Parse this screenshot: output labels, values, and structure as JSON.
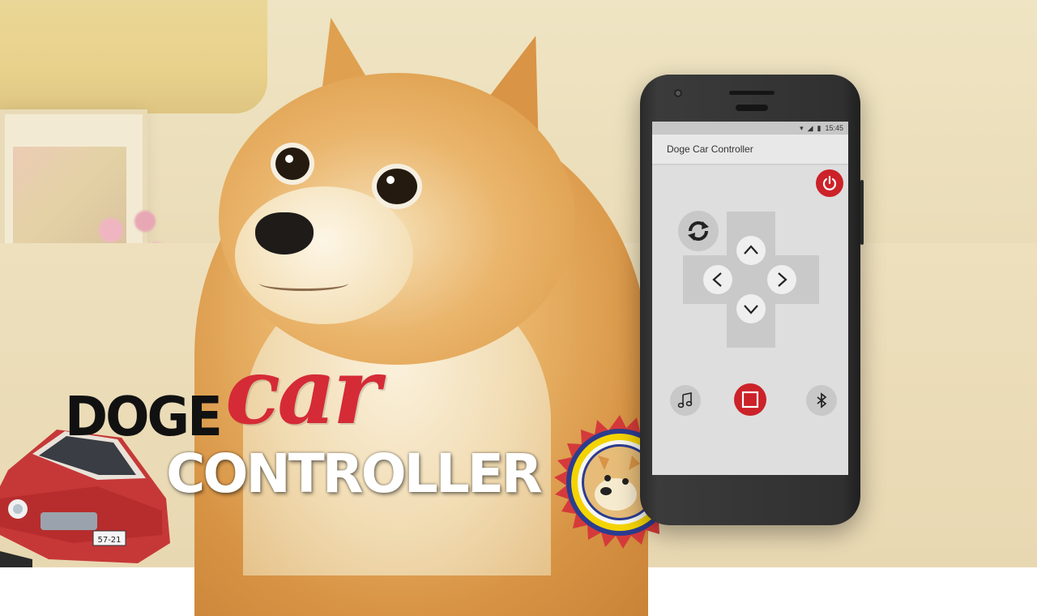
{
  "title": {
    "word1": "DOGE",
    "word2": "car",
    "word3": "CONTROLLER"
  },
  "toy_car": {
    "plate": "57-21"
  },
  "phone": {
    "status_time": "15:45",
    "app_title": "Doge Car Controller",
    "controls": {
      "power": "power-icon",
      "rotate": "rotate-icon",
      "up": "chevron-up-icon",
      "down": "chevron-down-icon",
      "left": "chevron-left-icon",
      "right": "chevron-right-icon",
      "music": "music-note-icon",
      "stop": "stop-icon",
      "bluetooth": "bluetooth-icon"
    }
  },
  "colors": {
    "accent_red": "#cc2229",
    "title_red": "#d52b36",
    "dpad_gray": "#c9c9c9"
  }
}
